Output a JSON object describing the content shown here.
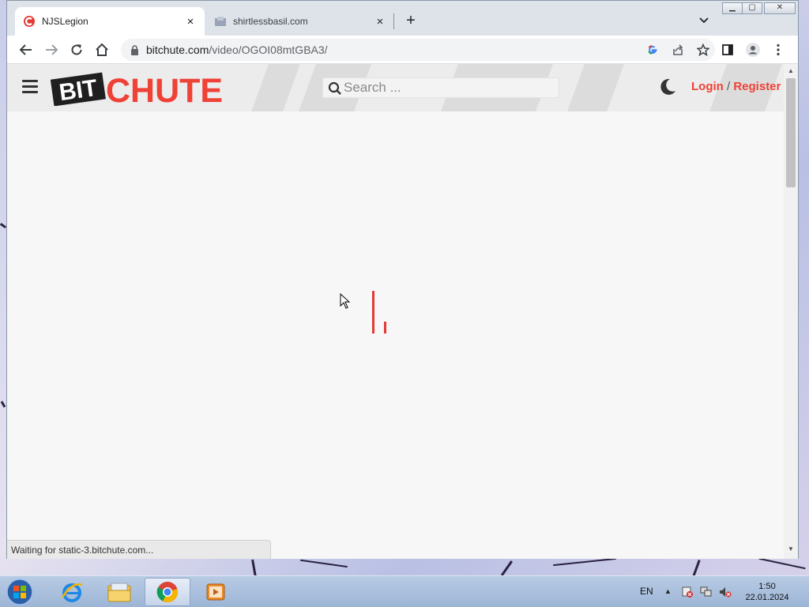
{
  "browser": {
    "tabs": [
      {
        "title": "NJSLegion",
        "close": "×",
        "active": true
      },
      {
        "title": "shirtlessbasil.com",
        "close": "×",
        "active": false
      }
    ],
    "new_tab_symbol": "+",
    "url_host": "bitchute.com",
    "url_path": "/video/OGOI08mtGBA3/",
    "status_text": "Waiting for static-3.bitchute.com..."
  },
  "site": {
    "logo_text_left": "BIT",
    "logo_text_right": "CHUTE",
    "search_placeholder": "Search ...",
    "login_label": "Login",
    "separator": "/",
    "register_label": "Register",
    "accent_color": "#ef4136"
  },
  "taskbar": {
    "language": "EN",
    "time": "1:50",
    "date": "22.01.2024"
  },
  "icons": [
    "menu-icon",
    "search-icon",
    "moon-icon",
    "lock-icon",
    "back-icon",
    "forward-icon",
    "reload-icon",
    "home-icon",
    "google-icon",
    "share-icon",
    "star-icon",
    "side-panel-icon",
    "profile-icon",
    "kebab-menu-icon"
  ]
}
